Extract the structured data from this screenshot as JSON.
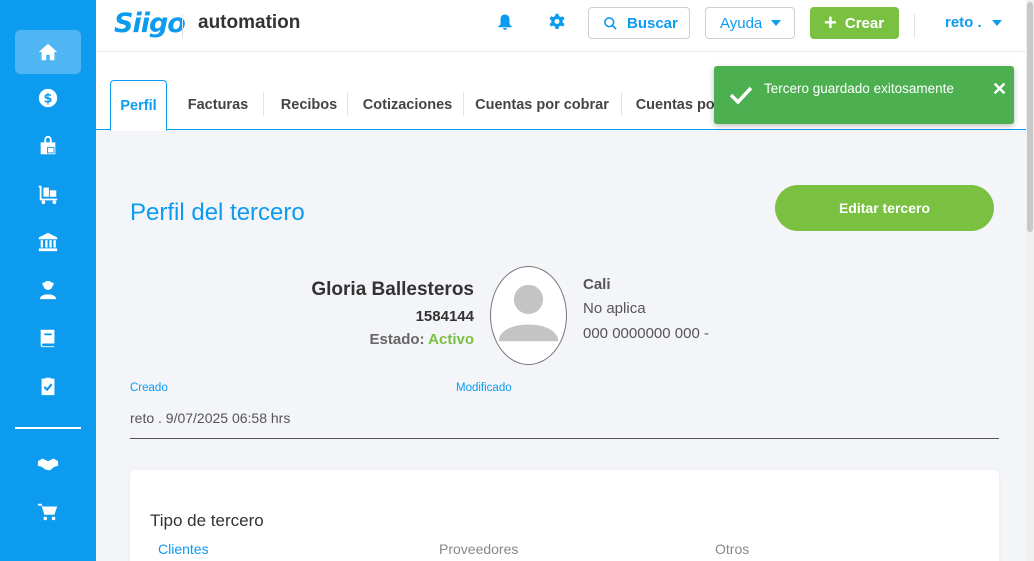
{
  "header": {
    "logo": "Siigo",
    "company": "automation",
    "search_label": "Buscar",
    "help_label": "Ayuda",
    "create_label": "Crear",
    "user_label": "reto ."
  },
  "sidebar": {
    "items": [
      {
        "icon": "home-icon",
        "active": true
      },
      {
        "icon": "dollar-icon",
        "active": false
      },
      {
        "icon": "shopping-bag-icon",
        "active": false
      },
      {
        "icon": "inventory-icon",
        "active": false
      },
      {
        "icon": "bank-icon",
        "active": false
      },
      {
        "icon": "user-icon",
        "active": false
      },
      {
        "icon": "book-icon",
        "active": false
      },
      {
        "icon": "clipboard-check-icon",
        "active": false
      },
      {
        "icon": "handshake-icon",
        "active": false
      },
      {
        "icon": "cart-icon",
        "active": false
      }
    ]
  },
  "tabs": [
    {
      "label": "Perfil",
      "active": true
    },
    {
      "label": "Facturas",
      "active": false
    },
    {
      "label": "Recibos",
      "active": false
    },
    {
      "label": "Cotizaciones",
      "active": false
    },
    {
      "label": "Cuentas por cobrar",
      "active": false
    },
    {
      "label": "Cuentas por",
      "active": false
    }
  ],
  "toast": {
    "message": "Tercero guardado exitosamente"
  },
  "profile": {
    "title": "Perfil del tercero",
    "edit_button": "Editar tercero",
    "name": "Gloria Ballesteros",
    "id": "1584144",
    "status_label": "Estado:",
    "status_value": "Activo",
    "city": "Cali",
    "no_aplica": "No aplica",
    "phone": "000 0000000 000 -",
    "created_label": "Creado",
    "modified_label": "Modificado",
    "created_value": "reto . 9/07/2025 06:58 hrs"
  },
  "tipo_tercero": {
    "title": "Tipo de tercero",
    "tabs": [
      "Clientes",
      "Proveedores",
      "Otros"
    ]
  },
  "colors": {
    "primary": "#0d9bf0",
    "green": "#7ac142",
    "toast": "#4caf50"
  }
}
